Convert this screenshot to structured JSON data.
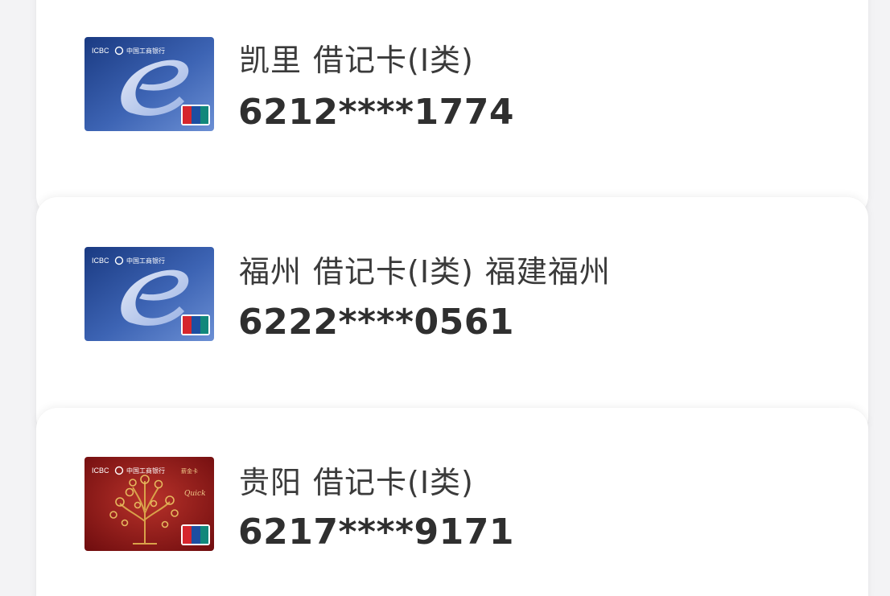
{
  "cards": [
    {
      "city": "凯里",
      "type": "借记卡(Ⅰ类)",
      "extra": "",
      "number": "6212****1774",
      "card_style": "blue-e-card"
    },
    {
      "city": "福州",
      "type": "借记卡(Ⅰ类)",
      "extra": "福建福州",
      "number": "6222****0561",
      "card_style": "blue-e-card"
    },
    {
      "city": "贵阳",
      "type": "借记卡(Ⅰ类)",
      "extra": "",
      "number": "6217****9171",
      "card_style": "red-tree-card"
    }
  ],
  "card_art": {
    "bank_abbr": "ICBC",
    "bank_name": "中国工商银行",
    "network": "UnionPay",
    "network_cn": "银联",
    "red_card_tag": "薪金卡",
    "red_card_mark": "Quick",
    "colors": {
      "blue_dark": "#1d3f86",
      "blue_light": "#5a7fc8",
      "red_dark": "#7a0f10",
      "red_light": "#b42a22",
      "gold": "#d9a24a"
    }
  }
}
